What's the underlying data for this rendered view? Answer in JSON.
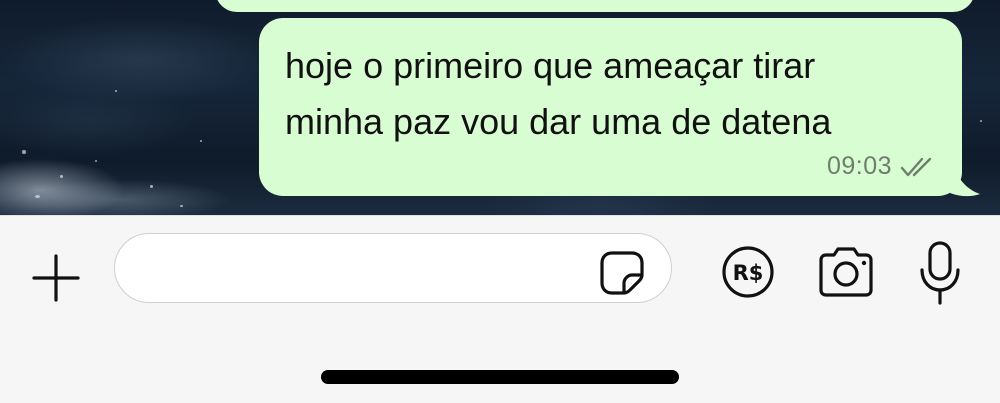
{
  "conversation": {
    "messages": [
      {
        "direction": "outgoing",
        "text_line_1": "hoje o primeiro que ameaçar tirar",
        "text_line_2": "minha paz vou dar uma de datena",
        "time": "09:03",
        "status_icon": "double-check-icon",
        "bubble_color": "#d9fdd3"
      }
    ]
  },
  "composer": {
    "message_value": "",
    "icons": {
      "attach": "plus-icon",
      "sticker": "sticker-icon",
      "payment": "real-currency-icon",
      "payment_symbol": "R$",
      "camera": "camera-icon",
      "microphone": "microphone-icon"
    }
  },
  "colors": {
    "bubble": "#d9fdd3",
    "input_bar": "#f6f6f6",
    "icon": "#111111",
    "timestamp": "#6f7d6c"
  }
}
